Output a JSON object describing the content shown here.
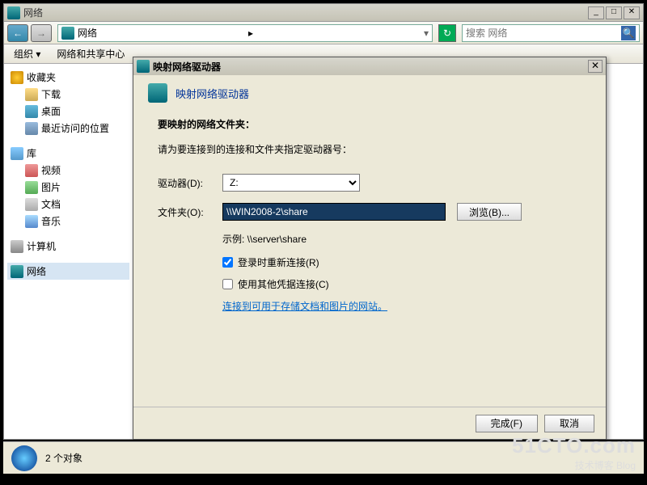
{
  "explorer": {
    "title": "网络",
    "window_buttons": {
      "min": "_",
      "max": "□",
      "close": "✕"
    },
    "nav_back": "←",
    "nav_fwd": "→",
    "address_text": "网络",
    "refresh": "↻",
    "search_placeholder": "搜索 网络",
    "toolbar2": {
      "organize": "组织 ▾",
      "netcenter": "网络和共享中心"
    }
  },
  "sidebar": {
    "favorites_label": "收藏夹",
    "favorites": [
      {
        "label": "下载",
        "icon": "folder"
      },
      {
        "label": "桌面",
        "icon": "desk"
      },
      {
        "label": "最近访问的位置",
        "icon": "recent"
      }
    ],
    "libraries_label": "库",
    "libraries": [
      {
        "label": "视频",
        "icon": "vid"
      },
      {
        "label": "图片",
        "icon": "pic"
      },
      {
        "label": "文档",
        "icon": "doc"
      },
      {
        "label": "音乐",
        "icon": "mus"
      }
    ],
    "computer_label": "计算机",
    "network_label": "网络"
  },
  "dialog": {
    "title": "映射网络驱动器",
    "header": "映射网络驱动器",
    "heading": "要映射的网络文件夹：",
    "subtext": "请为要连接到的连接和文件夹指定驱动器号：",
    "drive_label": "驱动器(D):",
    "drive_value": "Z:",
    "folder_label": "文件夹(O):",
    "folder_value": "\\\\WIN2008-2\\share",
    "browse": "浏览(B)...",
    "example": "示例: \\\\server\\share",
    "reconnect": "登录时重新连接(R)",
    "othercreds": "使用其他凭据连接(C)",
    "link": "连接到可用于存储文档和图片的网站。",
    "finish": "完成(F)",
    "cancel": "取消",
    "close": "✕"
  },
  "statusbar": {
    "text": "2 个对象"
  },
  "watermark": {
    "line1": "51CTO.com",
    "line2": "技术博客  Blog"
  }
}
